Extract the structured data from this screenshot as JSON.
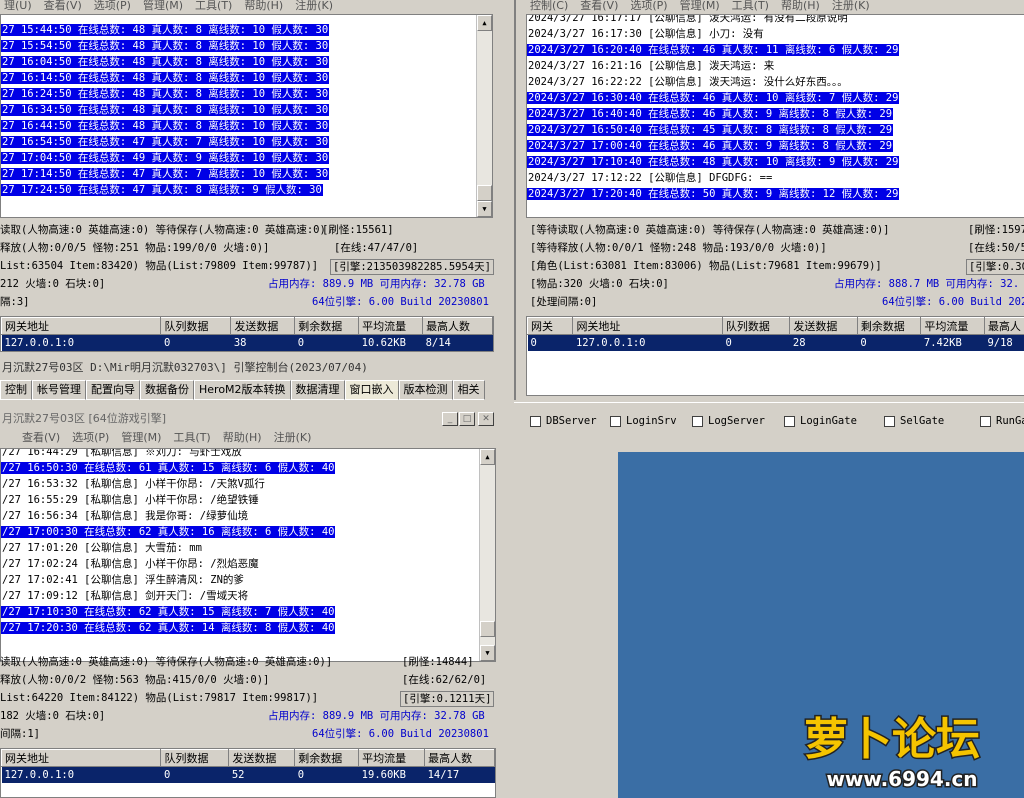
{
  "menu": [
    "查看(V)",
    "选项(P)",
    "管理(M)",
    "工具(T)",
    "帮助(H)",
    "注册(K)"
  ],
  "menu_r": [
    "控制(C)",
    "查看(V)",
    "选项(P)",
    "管理(M)",
    "工具(T)",
    "帮助(H)",
    "注册(K)"
  ],
  "menu_l_top": {
    "frag": "理(U)"
  },
  "tl": {
    "log": [
      {
        "t": "27 15:44:50 在线总数: 48 真人数: 8 离线数: 10 假人数: 30",
        "hl": true
      },
      {
        "t": "27 15:54:50 在线总数: 48 真人数: 8 离线数: 10 假人数: 30",
        "hl": true
      },
      {
        "t": "27 16:04:50 在线总数: 48 真人数: 8 离线数: 10 假人数: 30",
        "hl": true
      },
      {
        "t": "27 16:14:50 在线总数: 48 真人数: 8 离线数: 10 假人数: 30",
        "hl": true
      },
      {
        "t": "27 16:24:50 在线总数: 48 真人数: 8 离线数: 10 假人数: 30",
        "hl": true
      },
      {
        "t": "27 16:34:50 在线总数: 48 真人数: 8 离线数: 10 假人数: 30",
        "hl": true
      },
      {
        "t": "27 16:44:50 在线总数: 48 真人数: 8 离线数: 10 假人数: 30",
        "hl": true
      },
      {
        "t": "27 16:54:50 在线总数: 47 真人数: 7 离线数: 10 假人数: 30",
        "hl": true
      },
      {
        "t": "27 17:04:50 在线总数: 49 真人数: 9 离线数: 10 假人数: 30",
        "hl": true
      },
      {
        "t": "27 17:14:50 在线总数: 47 真人数: 7 离线数: 10 假人数: 30",
        "hl": true
      },
      {
        "t": "27 17:24:50 在线总数: 47 真人数: 8 离线数: 9 假人数: 30",
        "hl": true
      }
    ],
    "s1": "读取(人物高速:0 英雄高速:0) 等待保存(人物高速:0 英雄高速:0)",
    "s1r": "[刷怪:15561]",
    "s2": "释放(人物:0/0/5 怪物:251 物品:199/0/0 火墙:0)]",
    "s2r": "[在线:47/47/0]",
    "s3": "List:63504 Item:83420) 物品(List:79809 Item:99787)]",
    "s3r": "[引擎:213503982285.5954天]",
    "s4": "212 火墙:0 石块:0]",
    "s4r": "占用内存: 889.9 MB 可用内存: 32.78 GB",
    "s5": "隔:3]",
    "s5r": "64位引擎: 6.00 Build 20230801",
    "grid_head": [
      "网关地址",
      "队列数据",
      "发送数据",
      "剩余数据",
      "平均流量",
      "最高人数"
    ],
    "grid_row": [
      "127.0.0.1:0",
      "0",
      "38",
      "0",
      "10.62KB",
      "8/14"
    ]
  },
  "tr": {
    "log": [
      {
        "t": "2024/3/27 16:17:17 [公聊信息] 泼天鸿运: 有没有二段原说明",
        "hl": false
      },
      {
        "t": "2024/3/27 16:17:30 [公聊信息] 小刀: 没有",
        "hl": false
      },
      {
        "t": "2024/3/27 16:20:40 在线总数: 46 真人数: 11 离线数: 6 假人数: 29",
        "hl": true
      },
      {
        "t": "2024/3/27 16:21:16 [公聊信息] 泼天鸿运: 来",
        "hl": false
      },
      {
        "t": "2024/3/27 16:22:22 [公聊信息] 泼天鸿运: 没什么好东西。。。",
        "hl": false
      },
      {
        "t": "2024/3/27 16:30:40 在线总数: 46 真人数: 10 离线数: 7 假人数: 29",
        "hl": true
      },
      {
        "t": "2024/3/27 16:40:40 在线总数: 46 真人数: 9 离线数: 8 假人数: 29",
        "hl": true
      },
      {
        "t": "2024/3/27 16:50:40 在线总数: 45 真人数: 8 离线数: 8 假人数: 29",
        "hl": true
      },
      {
        "t": "2024/3/27 17:00:40 在线总数: 46 真人数: 9 离线数: 8 假人数: 29",
        "hl": true
      },
      {
        "t": "2024/3/27 17:10:40 在线总数: 48 真人数: 10 离线数: 9 假人数: 29",
        "hl": true
      },
      {
        "t": "2024/3/27 17:12:22 [公聊信息] DFGDFG: ==",
        "hl": false
      },
      {
        "t": "2024/3/27 17:20:40 在线总数: 50 真人数: 9 离线数: 12 假人数: 29",
        "hl": true
      }
    ],
    "s1": "[等待读取(人物高速:0 英雄高速:0) 等待保存(人物高速:0 英雄高速:0)]",
    "s1r": "[刷怪:1597",
    "s2": "[等待释放(人物:0/0/1 怪物:248 物品:193/0/0 火墙:0)]",
    "s2r": "[在线:50/5",
    "s3": "[角色(List:63081 Item:83006) 物品(List:79681 Item:99679)]",
    "s3r": "[引擎:0.30",
    "s4": "[物品:320 火墙:0 石块:0]",
    "s4r": "占用内存: 888.7 MB 可用内存: 32.",
    "s5": "[处理间隔:0]",
    "s5r": "64位引擎: 6.00 Build 202",
    "grid_head": [
      "网关",
      "网关地址",
      "队列数据",
      "发送数据",
      "剩余数据",
      "平均流量",
      "最高人"
    ],
    "grid_row": [
      "0",
      "127.0.0.1:0",
      "0",
      "28",
      "0",
      "7.42KB",
      "9/18"
    ]
  },
  "mid": {
    "title": "月沉默27号03区 D:\\Mir明月沉默032703\\] 引擎控制台(2023/07/04)",
    "tabs": [
      "控制",
      "帐号管理",
      "配置向导",
      "数据备份",
      "HeroM2版本转换",
      "数据清理",
      "窗口嵌入",
      "版本检测",
      "相关"
    ],
    "checks": [
      "DBServer",
      "LoginSrv",
      "LogServer",
      "LoginGate",
      "SelGate",
      "RunGa"
    ]
  },
  "bl": {
    "caption": "月沉默27号03区 [64位游戏引擎]",
    "log": [
      {
        "t": "/27 16:44:29 [私聊信息] ※刘刀: 与虾士戏放",
        "hl": false
      },
      {
        "t": "/27 16:50:30 在线总数: 61 真人数: 15 离线数: 6 假人数: 40",
        "hl": true
      },
      {
        "t": "/27 16:53:32 [私聊信息] 小样干你昂: /天煞V孤行",
        "hl": false
      },
      {
        "t": "/27 16:55:29 [私聊信息] 小样干你昂: /绝望铁锤",
        "hl": false
      },
      {
        "t": "/27 16:56:34 [私聊信息] 我是你哥: /绿萝仙境",
        "hl": false
      },
      {
        "t": "/27 17:00:30 在线总数: 62 真人数: 16 离线数: 6 假人数: 40",
        "hl": true
      },
      {
        "t": "/27 17:01:20 [公聊信息] 大雪茄: mm",
        "hl": false
      },
      {
        "t": "/27 17:02:24 [私聊信息] 小样干你昂: /烈焰恶魔",
        "hl": false
      },
      {
        "t": "/27 17:02:41 [公聊信息] 浮生醉清风: ZN的爹",
        "hl": false
      },
      {
        "t": "/27 17:09:12 [私聊信息] 剑开天门: /雪域天将",
        "hl": false
      },
      {
        "t": "/27 17:10:30 在线总数: 62 真人数: 15 离线数: 7 假人数: 40",
        "hl": true
      },
      {
        "t": "/27 17:20:30 在线总数: 62 真人数: 14 离线数: 8 假人数: 40",
        "hl": true
      }
    ],
    "s1": "读取(人物高速:0 英雄高速:0) 等待保存(人物高速:0 英雄高速:0)]",
    "s1r": "[刷怪:14844]",
    "s2": "释放(人物:0/0/2 怪物:563 物品:415/0/0 火墙:0)]",
    "s2r": "[在线:62/62/0]",
    "s3": "List:64220 Item:84122) 物品(List:79817 Item:99817)]",
    "s3r": "[引擎:0.1211天]",
    "s4": "182 火墙:0 石块:0]",
    "s4r": "占用内存: 889.9 MB 可用内存: 32.78 GB",
    "s5": "间隔:1]",
    "s5r": "64位引擎: 6.00 Build 20230801",
    "grid_head": [
      "网关地址",
      "队列数据",
      "发送数据",
      "剩余数据",
      "平均流量",
      "最高人数"
    ],
    "grid_row": [
      "127.0.0.1:0",
      "0",
      "52",
      "0",
      "19.60KB",
      "14/17"
    ]
  },
  "logo": {
    "text": "萝卜论坛",
    "url": "www.6994.cn"
  }
}
